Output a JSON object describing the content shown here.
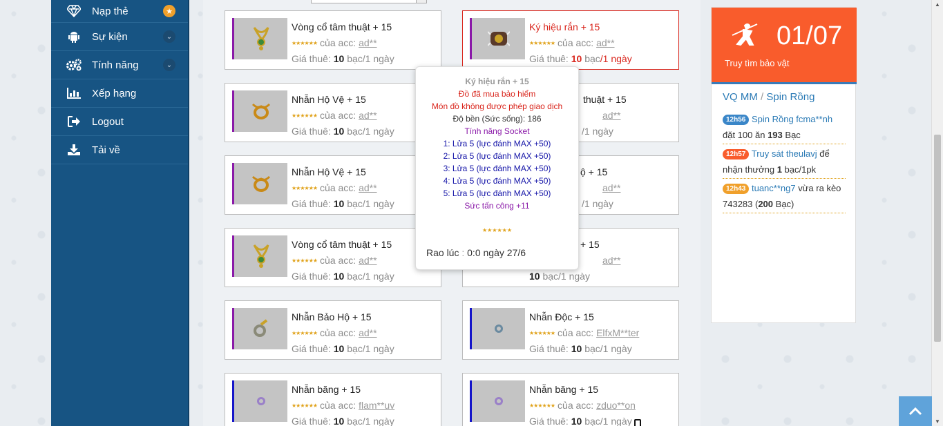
{
  "sidebar": {
    "items": [
      {
        "label": "Nạp thẻ",
        "icon": "diamond-icon",
        "badge": "★"
      },
      {
        "label": "Sự kiện",
        "icon": "android-icon",
        "badge": "⌄"
      },
      {
        "label": "Tính năng",
        "icon": "gears-icon",
        "badge": "⌄"
      },
      {
        "label": "Xếp hạng",
        "icon": "bar-chart-icon"
      },
      {
        "label": "Logout",
        "icon": "logout-icon"
      },
      {
        "label": "Tải về",
        "icon": "download-icon"
      }
    ]
  },
  "listings": [
    {
      "title": "Vòng cổ tâm thuật + 15",
      "acc_prefix": "của acc:",
      "acc": "ad**",
      "price_label": "Giá thuê:",
      "price": "10",
      "unit": "bạc",
      "per": "/1 ngày"
    },
    {
      "title": "Ký hiệu rắn + 15",
      "acc_prefix": "của acc:",
      "acc": "ad**",
      "price_label": "Giá thuê:",
      "price": "10",
      "unit": "bạc",
      "per": "/1 ngày"
    },
    {
      "title": "Nhẫn Hộ Vệ + 15",
      "acc_prefix": "của acc:",
      "acc": "ad**",
      "price_label": "Giá thuê:",
      "price": "10",
      "unit": "bạc",
      "per": "/1 ngày"
    },
    {
      "title": "thuật + 15",
      "acc_prefix": "",
      "acc": "ad**",
      "price_label": "",
      "price": "",
      "unit": "",
      "per": "/1 ngày"
    },
    {
      "title": "Nhẫn Hộ Vệ + 15",
      "acc_prefix": "của acc:",
      "acc": "ad**",
      "price_label": "Giá thuê:",
      "price": "10",
      "unit": "bạc",
      "per": "/1 ngày"
    },
    {
      "title": "ộ + 15",
      "acc_prefix": "",
      "acc": "ad**",
      "price_label": "",
      "price": "",
      "unit": "",
      "per": "/1 ngày"
    },
    {
      "title": "Vòng cổ tâm thuật + 15",
      "acc_prefix": "của acc:",
      "acc": "ad**",
      "price_label": "Giá thuê:",
      "price": "10",
      "unit": "bạc",
      "per": "/1 ngày"
    },
    {
      "title": "+ 15",
      "acc_prefix": "",
      "acc": "ad**",
      "price_label": "",
      "price": "10",
      "unit": "bạc",
      "per": "/1 ngày"
    },
    {
      "title": "Nhẫn Bảo Hộ + 15",
      "acc_prefix": "của acc:",
      "acc": "ad**",
      "price_label": "Giá thuê:",
      "price": "10",
      "unit": "bạc",
      "per": "/1 ngày"
    },
    {
      "title": "Nhẫn Độc + 15",
      "acc_prefix": "của acc:",
      "acc": "ElfxM**ter",
      "price_label": "Giá thuê:",
      "price": "10",
      "unit": "bạc",
      "per": "/1 ngày"
    },
    {
      "title": "Nhẫn băng + 15",
      "acc_prefix": "của acc:",
      "acc": "flam**uv",
      "price_label": "Giá thuê:",
      "price": "10",
      "unit": "bạc",
      "per": "/1 ngày"
    },
    {
      "title": "Nhẫn băng + 15",
      "acc_prefix": "của acc:",
      "acc": "zduo**on",
      "price_label": "Giá thuê:",
      "price": "10",
      "unit": "bạc",
      "per": "/1 ngày"
    }
  ],
  "stars": "★★★★★★",
  "tooltip": {
    "title": "Ký hiệu rắn + 15",
    "insured": "Đồ đã mua bảo hiểm",
    "no_trade": "Món đồ không được phép giao dịch",
    "durability": "Độ bền (Sức sống): 186",
    "socket_label": "Tính năng Socket",
    "sockets": [
      "1: Lửa 5 (lực đánh MAX +50)",
      "2: Lửa 5 (lực đánh MAX +50)",
      "3: Lửa 5 (lực đánh MAX +50)",
      "4: Lửa 5 (lực đánh MAX +50)",
      "5: Lửa 5 (lực đánh MAX +50)"
    ],
    "attack": "Sức tấn công +11",
    "stars": "★★★★★★",
    "posted_label": "Rao lúc",
    "posted_sep": ":",
    "posted_value": "0:0 ngày 27/6"
  },
  "promo": {
    "count": "01/07",
    "label": "Truy tìm bảo vật"
  },
  "feed_tabs": {
    "tab1": "VQ MM",
    "sep": "/",
    "tab2": "Spin Rồng"
  },
  "feed": [
    {
      "time": "12h56",
      "badge_color": "#3a86c8",
      "link": "Spin Rồng fcma**nh",
      "text1": "đặt 100 ăn",
      "bold": "193",
      "text2": "Bạc"
    },
    {
      "time": "12h57",
      "badge_color": "#f95c2c",
      "link": "Truy sát theulavj",
      "text1": "để nhận thưởng",
      "bold": "1",
      "text2": "bạc/1pk"
    },
    {
      "time": "12h43",
      "badge_color": "#f0a02b",
      "link": "tuanc**ng7",
      "text1": "vừa ra kèo 743283 (",
      "bold": "200",
      "text2": "Bạc)"
    }
  ]
}
